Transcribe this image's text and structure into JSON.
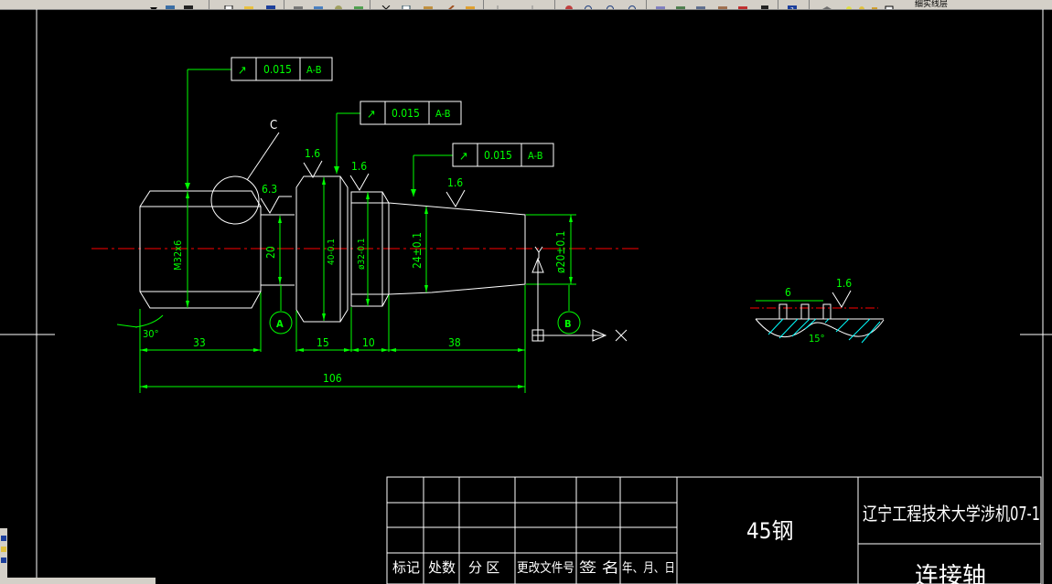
{
  "toolbar": {
    "layer_name": "细实线层"
  },
  "drawing": {
    "tolerance_frames": [
      {
        "symbol": "↗",
        "value": "0.015",
        "datum": "A-B"
      },
      {
        "symbol": "↗",
        "value": "0.015",
        "datum": "A-B"
      },
      {
        "symbol": "↗",
        "value": "0.015",
        "datum": "A-B"
      }
    ],
    "detail_label": "C",
    "roughness": [
      "6.3",
      "1.6",
      "1.6",
      "1.6",
      "1.6"
    ],
    "diameters": {
      "thread": "M32x6",
      "d20": "20",
      "d40": "40-0.1",
      "d32": "ø32-0.1",
      "taper": "24±0.1",
      "end": "ø20±0.1"
    },
    "datums": [
      "A",
      "B"
    ],
    "angles": {
      "chamfer": "30°",
      "detail_small": "15°"
    },
    "lengths": {
      "a": "33",
      "b": "15",
      "c": "10",
      "d": "38",
      "total": "106"
    },
    "detail_dim": "6"
  },
  "title_block": {
    "headers": [
      "标记",
      "处数",
      "分  区",
      "更改文件号",
      "签  名",
      "年、月、日"
    ],
    "material": "45钢",
    "school": "辽宁工程技术大学涉机07-1",
    "part_name": "连接轴"
  },
  "colors": {
    "background": "#000000",
    "dimension": "#00ff00",
    "outline": "#ffffff",
    "centerline": "#ff0000",
    "hatch": "#00ffff",
    "toolbar": "#d4d0c8"
  }
}
